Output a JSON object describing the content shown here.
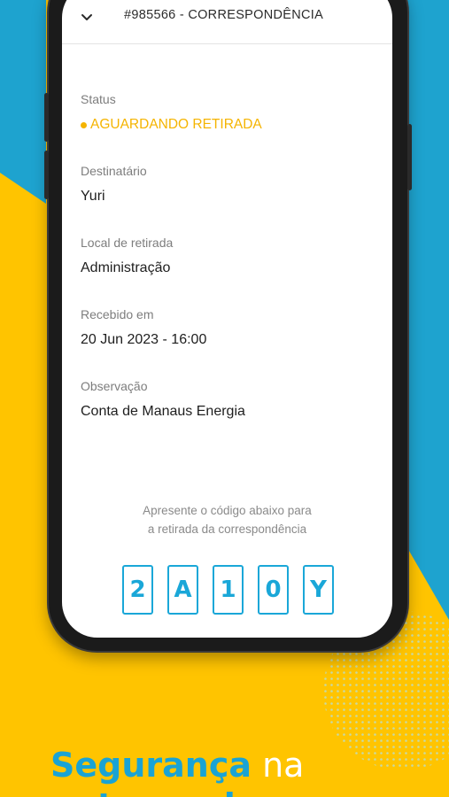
{
  "colors": {
    "background_yellow": "#ffc400",
    "background_blue": "#1ea3cf",
    "accent_blue": "#1aa7d8",
    "status_yellow": "#f5b400"
  },
  "header": {
    "icon": "chevron-down-icon",
    "title": "#985566 - CORRESPONDÊNCIA"
  },
  "details": {
    "status_label": "Status",
    "status_value": "AGUARDANDO RETIRADA",
    "recipient_label": "Destinatário",
    "recipient_value": "Yuri",
    "pickup_label": "Local de retirada",
    "pickup_value": "Administração",
    "received_label": "Recebido em",
    "received_value": "20 Jun 2023 - 16:00",
    "notes_label": "Observação",
    "notes_value": "Conta de Manaus Energia"
  },
  "pickup_code": {
    "instruction_line1": "Apresente o código abaixo para",
    "instruction_line2": "a retirada da correspondência",
    "chars": [
      "2",
      "A",
      "1",
      "0",
      "Y"
    ]
  },
  "promo": {
    "headline_strong": "Segurança",
    "headline_light": "na",
    "headline_line2": "entrega de"
  }
}
